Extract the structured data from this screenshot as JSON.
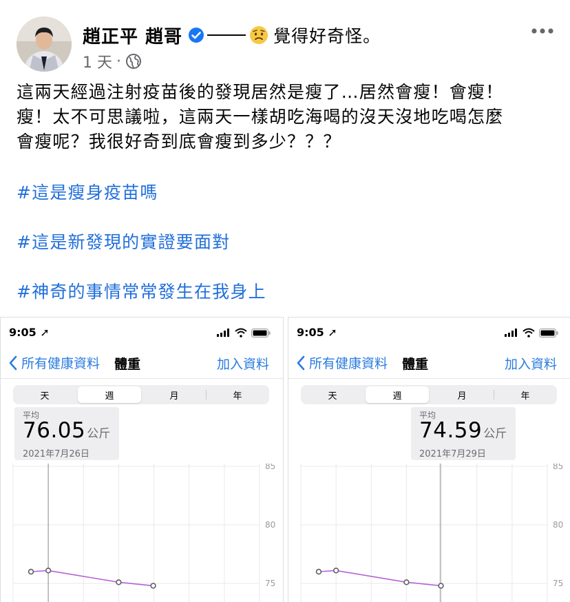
{
  "post": {
    "author_name": "趙正平 趙哥",
    "feeling": "覺得好奇怪。",
    "timestamp": "1 天",
    "meta_separator": "·",
    "body": [
      "這兩天經過注射疫苗後的發現居然是瘦了…居然會瘦！會瘦！",
      "瘦！太不可思議啦，這兩天一樣胡吃海喝的沒天沒地吃喝怎麼",
      "會瘦呢？我很好奇到底會瘦到多少？？？"
    ],
    "hashtags": [
      "#這是瘦身疫苗嗎",
      "#這是新發現的實證要面對",
      "#神奇的事情常常發生在我身上"
    ],
    "icons": {
      "verified": "verified-badge-icon",
      "feeling": "worried-face-icon",
      "audience": "globe-icon",
      "more": "more-options-icon"
    },
    "colors": {
      "hashtag": "#216fdb",
      "verified": "#1877f2",
      "meta": "#65676b"
    }
  },
  "screenshots": [
    {
      "status_time": "9:05",
      "nav": {
        "back_label": "所有健康資料",
        "title": "體重",
        "add_label": "加入資料"
      },
      "segments": [
        "天",
        "週",
        "月",
        "年"
      ],
      "selected_segment": "週",
      "summary": {
        "label": "平均",
        "value": "76.05",
        "unit": "公斤",
        "date": "2021年7月26日"
      }
    },
    {
      "status_time": "9:05",
      "nav": {
        "back_label": "所有健康資料",
        "title": "體重",
        "add_label": "加入資料"
      },
      "segments": [
        "天",
        "週",
        "月",
        "年"
      ],
      "selected_segment": "週",
      "summary": {
        "label": "平均",
        "value": "74.59",
        "unit": "公斤",
        "date": "2021年7月29日"
      }
    }
  ],
  "chart_data": [
    {
      "type": "line",
      "y_ticks": [
        "85",
        "80",
        "75"
      ],
      "ylim": [
        70,
        85
      ],
      "points": [
        {
          "day_index": 0,
          "value": 76.0
        },
        {
          "day_index": 1,
          "value": 76.1
        },
        {
          "day_index": 3,
          "value": 75.1
        },
        {
          "day_index": 4,
          "value": 74.8
        }
      ],
      "selected_day_index": 1,
      "line_color": "#b561d6"
    },
    {
      "type": "line",
      "y_ticks": [
        "85",
        "80",
        "75"
      ],
      "ylim": [
        70,
        85
      ],
      "points": [
        {
          "day_index": 0,
          "value": 76.0
        },
        {
          "day_index": 1,
          "value": 76.1
        },
        {
          "day_index": 3,
          "value": 75.1
        },
        {
          "day_index": 4,
          "value": 74.8
        }
      ],
      "selected_day_index": 4,
      "line_color": "#b561d6"
    }
  ]
}
